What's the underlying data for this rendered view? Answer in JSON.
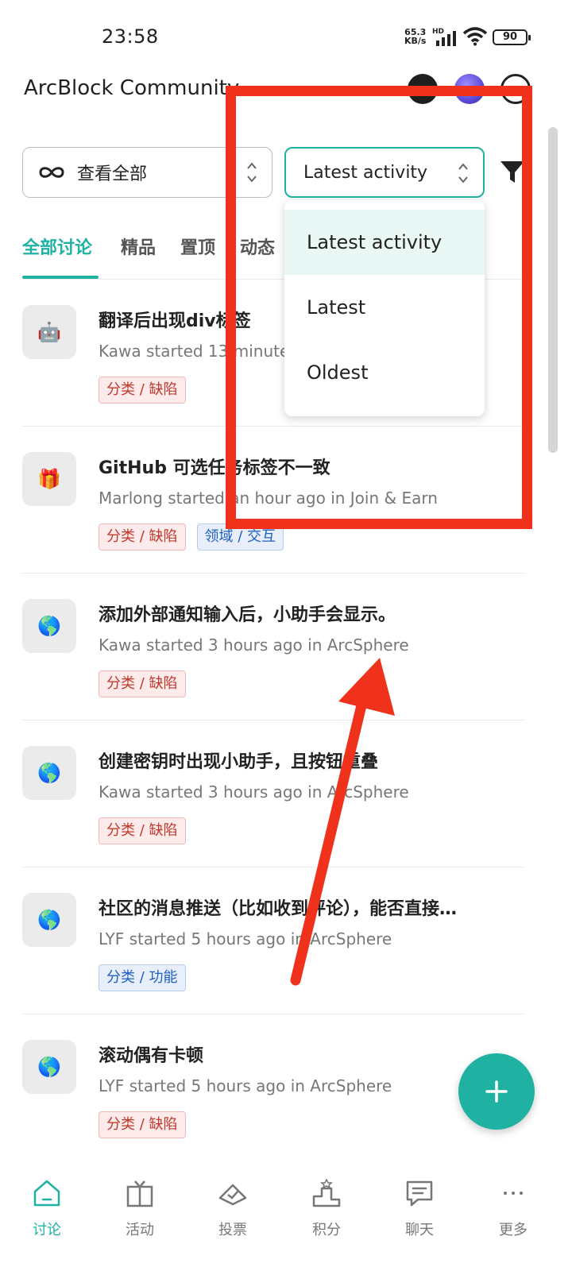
{
  "status_bar": {
    "time": "23:58",
    "net_speed_value": "65.3",
    "net_speed_unit": "KB/s",
    "network_type": "HD",
    "battery_level": "90"
  },
  "header": {
    "title": "ArcBlock Community"
  },
  "filters": {
    "scope_label": "查看全部",
    "sort_label": "Latest activity"
  },
  "tabs": [
    {
      "label": "全部讨论",
      "active": true
    },
    {
      "label": "精品"
    },
    {
      "label": "置顶"
    },
    {
      "label": "动态"
    }
  ],
  "sort_dropdown": {
    "options": [
      "Latest activity",
      "Latest",
      "Oldest"
    ],
    "selected": "Latest activity"
  },
  "topics": [
    {
      "icon": "robot-icon",
      "title": "翻译后出现div标签",
      "meta": "Kawa started 13 minutes ago in ArcSphere",
      "tags": [
        {
          "label": "分类 / 缺陷",
          "color": "red"
        }
      ]
    },
    {
      "icon": "gift-icon",
      "title": "GitHub 可选任务标签不一致",
      "meta": "Marlong started an hour ago in Join & Earn",
      "tags": [
        {
          "label": "分类 / 缺陷",
          "color": "red"
        },
        {
          "label": "领域 / 交互",
          "color": "blue"
        }
      ]
    },
    {
      "icon": "globe-icon",
      "title": "添加外部通知输入后，小助手会显示。",
      "meta": "Kawa started 3 hours ago in ArcSphere",
      "tags": [
        {
          "label": "分类 / 缺陷",
          "color": "red"
        }
      ]
    },
    {
      "icon": "globe-icon",
      "title": "创建密钥时出现小助手，且按钮重叠",
      "meta": "Kawa started 3 hours ago in ArcSphere",
      "tags": [
        {
          "label": "分类 / 缺陷",
          "color": "red"
        }
      ]
    },
    {
      "icon": "globe-icon",
      "title": "社区的消息推送（比如收到评论），能否直接…",
      "meta": "LYF started 5 hours ago in ArcSphere",
      "tags": [
        {
          "label": "分类 / 功能",
          "color": "blue"
        }
      ]
    },
    {
      "icon": "globe-icon",
      "title": "滚动偶有卡顿",
      "meta": "LYF started 5 hours ago in ArcSphere",
      "tags": [
        {
          "label": "分类 / 缺陷",
          "color": "red"
        }
      ]
    }
  ],
  "bottom_nav": [
    {
      "label": "讨论",
      "icon": "home-icon",
      "active": true
    },
    {
      "label": "活动",
      "icon": "gift-box-icon"
    },
    {
      "label": "投票",
      "icon": "vote-icon"
    },
    {
      "label": "积分",
      "icon": "podium-icon"
    },
    {
      "label": "聊天",
      "icon": "chat-icon"
    },
    {
      "label": "更多",
      "icon": "more-icon"
    }
  ],
  "colors": {
    "accent": "#1fb2a2",
    "annotation": "#f0321c",
    "tag_red": "#c0392b",
    "tag_blue": "#1f5fc0"
  }
}
